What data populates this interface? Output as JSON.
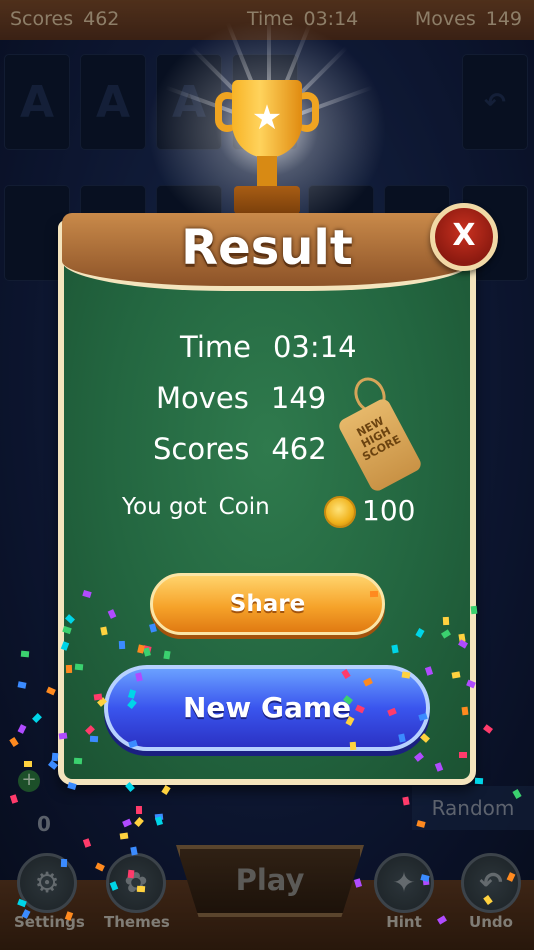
{
  "status_bar": {
    "scores_label": "Scores",
    "scores_value": "462",
    "time_label": "Time",
    "time_value": "03:14",
    "moves_label": "Moves",
    "moves_value": "149"
  },
  "board": {
    "foundation_cards": [
      "A",
      "A",
      "A"
    ],
    "undo_glyph": "↶"
  },
  "result_dialog": {
    "title": "Result",
    "close_label": "X",
    "time_label": "Time",
    "time_value": "03:14",
    "moves_label": "Moves",
    "moves_value": "149",
    "scores_label": "Scores",
    "scores_value": "462",
    "tag_text": "NEW HIGH SCORE",
    "coin_prefix": "You got",
    "coin_word": "Coin",
    "coin_amount": "100",
    "share_label": "Share",
    "new_game_label": "New Game"
  },
  "bottom_bar": {
    "settings_label": "Settings",
    "themes_label": "Themes",
    "play_label": "Play",
    "hint_label": "Hint",
    "undo_label": "Undo",
    "random_label": "Random",
    "counter_value": "0",
    "plus_glyph": "+"
  },
  "colors": {
    "panel_green": "#236640",
    "panel_border": "#f4e4bd",
    "header_wood": "#b0713a",
    "close_red": "#c93120",
    "share_orange": "#f6a32a",
    "new_game_blue": "#3a55ee"
  }
}
